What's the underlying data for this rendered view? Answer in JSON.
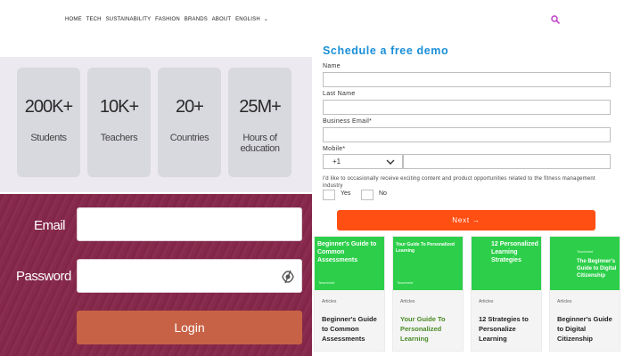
{
  "nav": {
    "items": [
      "HOME",
      "TECH",
      "SUSTAINABILITY",
      "FASHION",
      "BRANDS",
      "ABOUT",
      "ENGLISH"
    ]
  },
  "stats": [
    {
      "value": "200K+",
      "label": "Students"
    },
    {
      "value": "10K+",
      "label": "Teachers"
    },
    {
      "value": "20+",
      "label": "Countries"
    },
    {
      "value": "25M+",
      "label": "Hours of education"
    }
  ],
  "login": {
    "email_label": "Email",
    "password_label": "Password",
    "button_label": "Login"
  },
  "demo": {
    "title": "Schedule a free demo",
    "name_label": "Name",
    "last_name_label": "Last Name",
    "email_label": "Business Email*",
    "mobile_label": "Mobile*",
    "country_code": "+1",
    "consent_text": "I'd like to occasionally receive exciting content and product opportunities related to the fitness management industry",
    "yes_label": "Yes",
    "no_label": "No",
    "next_label": "Next →"
  },
  "cards": [
    {
      "thumb_title": "Beginner's Guide to Common Assessments",
      "thumb_brand": "Teachmint",
      "category": "Articles",
      "title": "Beginner's Guide to Common Assessments",
      "highlight": false
    },
    {
      "thumb_title": "Your Guide To Personalized Learning",
      "thumb_brand": "Teachmint",
      "category": "Articles",
      "title": "Your Guide To Personalized Learning",
      "highlight": true
    },
    {
      "thumb_title": "12 Personalized Learning Strategies",
      "thumb_brand": "",
      "category": "Articles",
      "title": "12 Strategies to Personalize Learning",
      "highlight": false
    },
    {
      "thumb_title": "The Beginner's Guide to Digital Citizenship",
      "thumb_brand": "Teachmint",
      "category": "Articles",
      "title": "Beginner's Guide to Digital Citizenship",
      "highlight": false
    }
  ],
  "colors": {
    "accent_blue": "#1a8fd8",
    "next_orange": "#ff4f13",
    "login_bg": "#8a2b4e",
    "login_button": "#c76246",
    "card_green": "#2dcf4a",
    "search_icon": "#c040c8"
  },
  "icons": {
    "search": "search-icon",
    "eye": "eye-off-icon",
    "chevron": "chevron-down-icon",
    "arrow": "arrow-right-icon"
  }
}
